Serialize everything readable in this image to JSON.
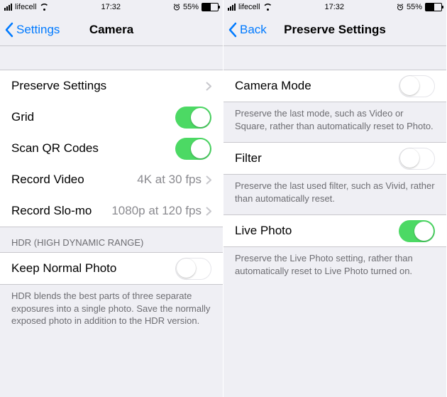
{
  "status": {
    "carrier": "lifecell",
    "time": "17:32",
    "battery": "55%"
  },
  "left": {
    "back": "Settings",
    "title": "Camera",
    "rows": {
      "preserve": "Preserve Settings",
      "grid": "Grid",
      "qr": "Scan QR Codes",
      "recvid_label": "Record Video",
      "recvid_detail": "4K at 30 fps",
      "recslo_label": "Record Slo-mo",
      "recslo_detail": "1080p at 120 fps"
    },
    "hdr_header": "HDR (High Dynamic Range)",
    "keep_normal": "Keep Normal Photo",
    "hdr_footer": "HDR blends the best parts of three separate exposures into a single photo. Save the normally exposed photo in addition to the HDR version."
  },
  "right": {
    "back": "Back",
    "title": "Preserve Settings",
    "camera_mode": "Camera Mode",
    "camera_mode_footer": "Preserve the last mode, such as Video or Square, rather than automatically reset to Photo.",
    "filter": "Filter",
    "filter_footer": "Preserve the last used filter, such as Vivid, rather than automatically reset.",
    "live": "Live Photo",
    "live_footer": "Preserve the Live Photo setting, rather than automatically reset to Live Photo turned on."
  }
}
